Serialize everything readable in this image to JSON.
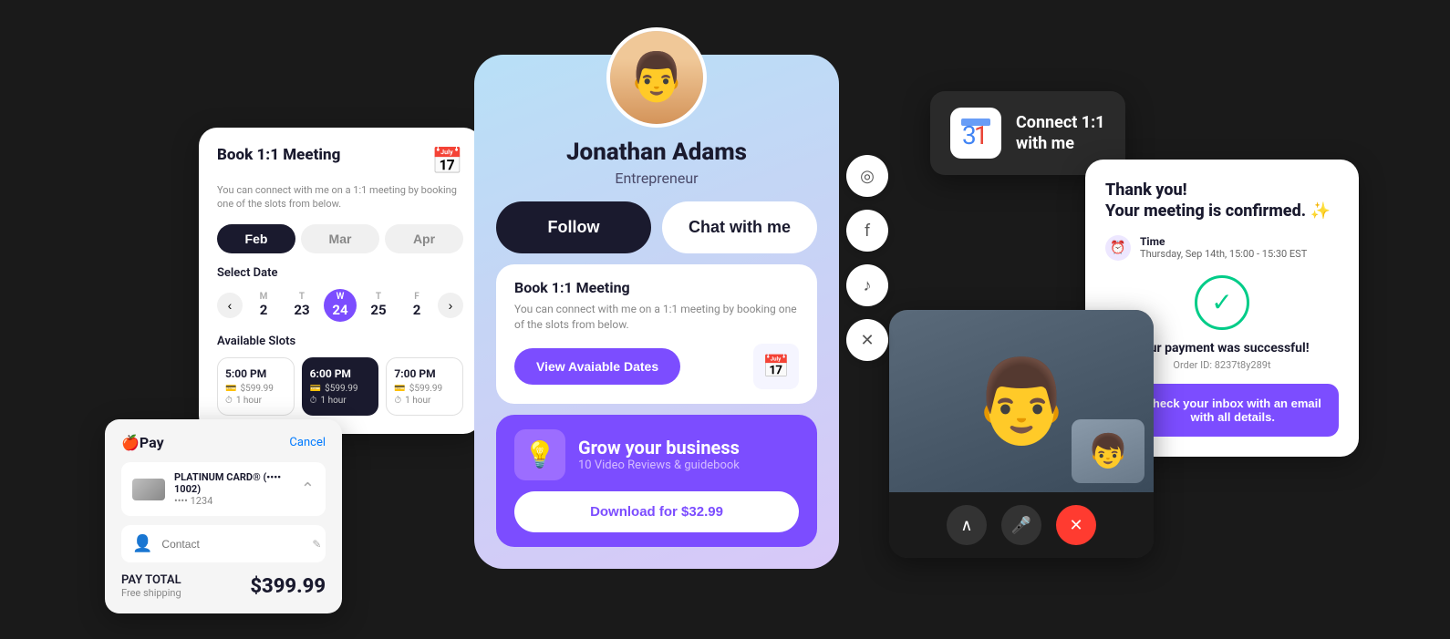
{
  "profile": {
    "name": "Jonathan Adams",
    "title": "Entrepreneur",
    "follow_label": "Follow",
    "chat_label": "Chat with me"
  },
  "booking_card": {
    "title": "Book 1:1 Meeting",
    "description": "You can connect with me on a 1:1 meeting by booking one of the slots from below.",
    "months": [
      "Feb",
      "Mar",
      "Apr"
    ],
    "active_month": "Feb",
    "select_date_label": "Select Date",
    "dates": [
      {
        "day": "M",
        "num": "2"
      },
      {
        "day": "T",
        "num": "23"
      },
      {
        "day": "W",
        "num": "24",
        "selected": true
      },
      {
        "day": "T",
        "num": "25"
      },
      {
        "day": "F",
        "num": "2"
      }
    ],
    "available_slots_label": "Available Slots",
    "slots": [
      {
        "time": "5:00 PM",
        "price": "$599.99",
        "duration": "1 hour",
        "selected": false
      },
      {
        "time": "6:00 PM",
        "price": "$599.99",
        "duration": "1 hour",
        "selected": true
      },
      {
        "time": "7:00 PM",
        "price": "$599.99",
        "duration": "1 hour",
        "selected": false
      }
    ]
  },
  "booking_mini": {
    "title": "Book 1:1 Meeting",
    "description": "You can connect with me on a 1:1 meeting by booking one of the slots from below.",
    "button_label": "View Avaiable Dates"
  },
  "grow_card": {
    "title": "Grow your business",
    "subtitle": "10 Video Reviews & guidebook",
    "button_label": "Download for $32.99"
  },
  "social_icons": [
    "©",
    "f",
    "♪",
    "✕"
  ],
  "applepay": {
    "logo": "🍎Pay",
    "cancel_label": "Cancel",
    "card_name": "PLATINUM CARD® (•••• 1002)",
    "card_dots": "•••• 1234",
    "contact_placeholder": "Contact",
    "pay_total_label": "PAY TOTAL",
    "shipping_label": "Free shipping",
    "amount": "$399.99"
  },
  "gcal": {
    "icon": "📅",
    "text": "Connect 1:1\nwith me"
  },
  "confirmation": {
    "title": "Thank you!\nYour meeting is confirmed.",
    "sparkle": "✨",
    "time_label": "Time",
    "time_value": "Thursday, Sep 14th, 15:00 - 15:30 EST",
    "payment_success": "Your payment was successful!",
    "order_id": "Order ID: 8237t8y289t",
    "email_btn_label": "Check your inbox with an email with all details."
  },
  "video": {
    "controls": {
      "up": "∧",
      "mic": "🎤",
      "end": "✕"
    }
  }
}
